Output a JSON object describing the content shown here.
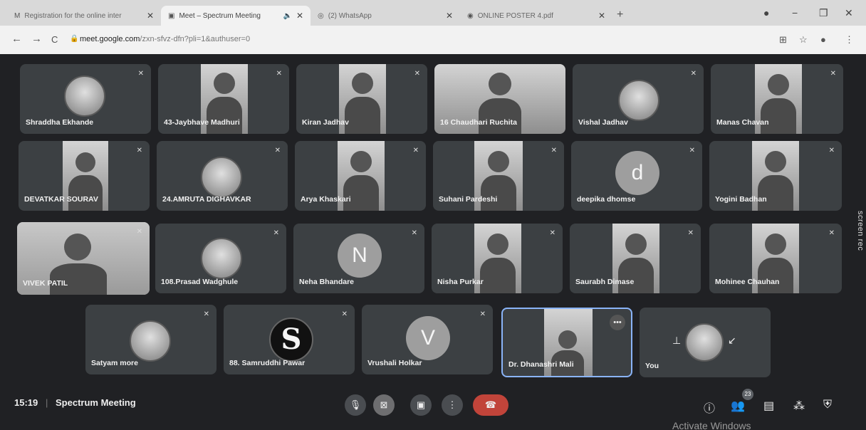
{
  "tabs": [
    {
      "favicon": "M",
      "title": "Registration for the online inter",
      "close": "✕"
    },
    {
      "favicon": "▣",
      "title": "Meet – Spectrum Meeting",
      "close": "✕",
      "audio": "🔈"
    },
    {
      "favicon": "◎",
      "title": "(2) WhatsApp",
      "close": "✕"
    },
    {
      "favicon": "◉",
      "title": "ONLINE POSTER 4.pdf",
      "close": "✕"
    }
  ],
  "new_tab": "+",
  "window_controls": {
    "minimize": "−",
    "restore": "❐",
    "close": "✕"
  },
  "address": {
    "host": "meet.google.com",
    "path": "/zxn-sfvz-dfn?pli=1&authuser=0"
  },
  "nav": {
    "back": "←",
    "forward": "→",
    "reload": "C"
  },
  "participants": [
    {
      "name": "Shraddha Ekhande",
      "kind": "avatar"
    },
    {
      "name": "43-Jaybhave Madhuri",
      "kind": "video"
    },
    {
      "name": "Kiran Jadhav",
      "kind": "video"
    },
    {
      "name": "16 Chaudhari Ruchita",
      "kind": "video"
    },
    {
      "name": "Vishal Jadhav",
      "kind": "avatar"
    },
    {
      "name": "Manas Chavan",
      "kind": "video"
    },
    {
      "name": "DEVATKAR SOURAV",
      "kind": "video"
    },
    {
      "name": "24.AMRUTA DIGHAVKAR",
      "kind": "avatar"
    },
    {
      "name": "Arya Khaskari",
      "kind": "video"
    },
    {
      "name": "Suhani Pardeshi",
      "kind": "video"
    },
    {
      "name": "deepika dhomse",
      "kind": "letter",
      "letter": "d"
    },
    {
      "name": "Yogini Badhan",
      "kind": "video"
    },
    {
      "name": "VIVEK PATIL",
      "kind": "video"
    },
    {
      "name": "108.Prasad Wadghule",
      "kind": "avatar"
    },
    {
      "name": "Neha Bhandare",
      "kind": "letter",
      "letter": "N"
    },
    {
      "name": "Nisha Purkar",
      "kind": "video"
    },
    {
      "name": "Saurabh Dimase",
      "kind": "video"
    },
    {
      "name": "Mohinee Chauhan",
      "kind": "video"
    },
    {
      "name": "Satyam more",
      "kind": "avatar"
    },
    {
      "name": "88. Samruddhi Pawar",
      "kind": "letter",
      "letter": "S"
    },
    {
      "name": "Vrushali Holkar",
      "kind": "letter",
      "letter": "V"
    },
    {
      "name": "Dr. Dhanashri Mali",
      "kind": "video"
    },
    {
      "name": "You",
      "kind": "avatar"
    }
  ],
  "screen_rec": "screen rec",
  "bottom": {
    "time": "15:19",
    "separator": "|",
    "meeting_title": "Spectrum Meeting",
    "participant_count": "23",
    "watermark": "Activate Windows"
  },
  "more_dots": "•••"
}
